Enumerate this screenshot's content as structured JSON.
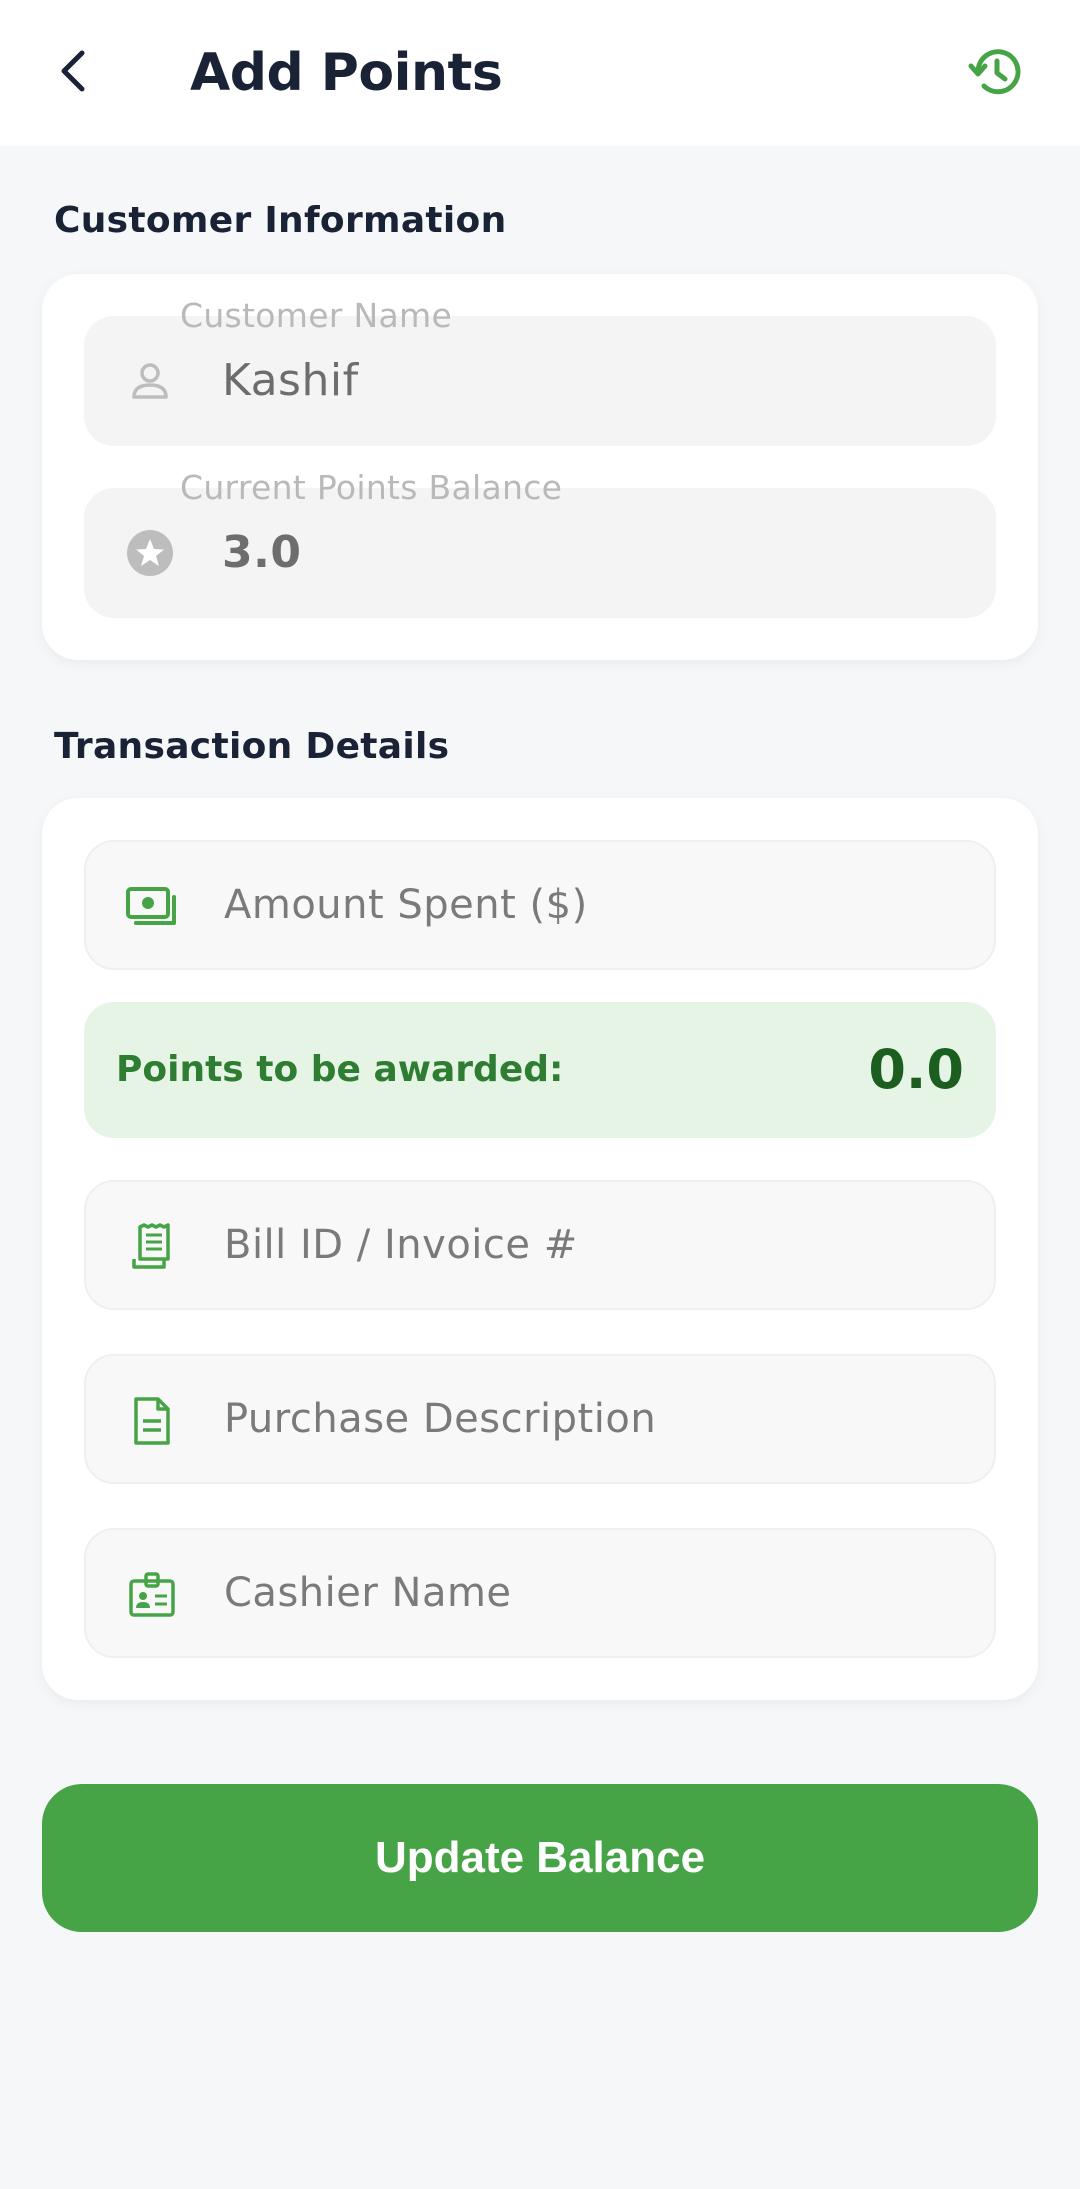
{
  "header": {
    "title": "Add Points",
    "back_icon": "chevron-left-icon",
    "history_icon": "history-icon"
  },
  "customer_section": {
    "title": "Customer Information",
    "customer_name": {
      "label": "Customer Name",
      "value": "Kashif",
      "icon": "person-icon"
    },
    "points_balance": {
      "label": "Current Points Balance",
      "value": "3.0",
      "icon": "star-circle-icon"
    }
  },
  "transaction_section": {
    "title": "Transaction Details",
    "amount": {
      "placeholder": "Amount Spent ($)",
      "icon": "money-icon"
    },
    "points_awarded": {
      "label": "Points to be awarded:",
      "value": "0.0"
    },
    "bill_id": {
      "placeholder": "Bill ID / Invoice #",
      "icon": "receipt-icon"
    },
    "description": {
      "placeholder": "Purchase Description",
      "icon": "document-icon"
    },
    "cashier": {
      "placeholder": "Cashier Name",
      "icon": "badge-icon"
    }
  },
  "actions": {
    "update_label": "Update Balance"
  },
  "colors": {
    "accent": "#46a447",
    "accent_dark": "#2e7d32",
    "awarded_bg": "#e6f4e6",
    "text_dark": "#1a2236"
  }
}
